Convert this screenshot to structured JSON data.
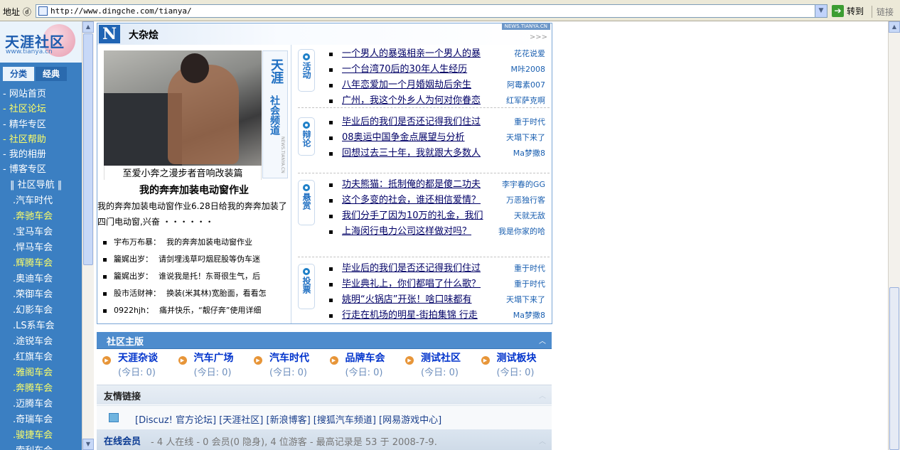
{
  "browser": {
    "address_label": "地址 ⓓ",
    "url": "http://www.dingche.com/tianya/",
    "go_label": "转到",
    "links_label": "链接"
  },
  "sidebar": {
    "logo_text": "天涯社区",
    "logo_sub": "www.tianya.cn",
    "tabs": [
      "分类",
      "经典"
    ],
    "nav": [
      {
        "label": "- 网站首页",
        "hl": false
      },
      {
        "label": "- 社区论坛",
        "hl": true
      },
      {
        "label": "- 精华专区",
        "hl": false
      },
      {
        "label": "- 社区帮助",
        "hl": true
      },
      {
        "label": "- 我的相册",
        "hl": false
      },
      {
        "label": "- 博客专区",
        "hl": false
      }
    ],
    "nav_head": "‖ 社区导航 ‖",
    "sub": [
      {
        "label": ".汽车时代",
        "hl": false
      },
      {
        "label": ".奔驰车会",
        "hl": true
      },
      {
        "label": ".宝马车会",
        "hl": false
      },
      {
        "label": ".悍马车会",
        "hl": false
      },
      {
        "label": ".辉腾车会",
        "hl": true
      },
      {
        "label": ".奥迪车会",
        "hl": false
      },
      {
        "label": ".荣御车会",
        "hl": false
      },
      {
        "label": ".幻影车会",
        "hl": false
      },
      {
        "label": ".LS系车会",
        "hl": false
      },
      {
        "label": ".途锐车会",
        "hl": false
      },
      {
        "label": ".红旗车会",
        "hl": false
      },
      {
        "label": ".雅阁车会",
        "hl": true
      },
      {
        "label": ".奔腾车会",
        "hl": true
      },
      {
        "label": ".迈腾车会",
        "hl": false
      },
      {
        "label": ".奇瑞车会",
        "hl": false
      },
      {
        "label": ".骏捷车会",
        "hl": true
      },
      {
        "label": ".索利车会",
        "hl": false
      }
    ]
  },
  "news": {
    "title": "大杂烩",
    "tag": "NEWS.TIANYA.CN",
    "more": ">>>",
    "photo_caption": "至爱小奔之漫步者音响改装篇",
    "channel_big": "天涯",
    "channel_small": "社会频道",
    "channel_tiny": "NEWS.TIANYA.CN",
    "headline": "我的奔奔加装电动窗作业",
    "summary": "我的奔奔加装电动窗作业6.28日给我的奔奔加装了四门电动窗,兴奋 ・・・・・・",
    "posts": [
      {
        "who": "宇布万布暴：",
        "text": "我的奔奔加装电动窗作业"
      },
      {
        "who": "籭娓出岁：",
        "text": "请剑埋浅草叼烟屁股等伪车迷"
      },
      {
        "who": "籭娓出岁：",
        "text": "谁说我是托！东哥很生气，后"
      },
      {
        "who": "股市活财神：",
        "text": "换装(米其林)宽胎面，看看怎"
      },
      {
        "who": "0922hjh：",
        "text": "痛并快乐，“靓仔奔”使用详细"
      }
    ],
    "categories": [
      {
        "name": "活动",
        "items": [
          {
            "title": "一个男人的暴强相亲一个男人的暴",
            "author": "花花说爱"
          },
          {
            "title": "一个台湾70后的30年人生经历",
            "author": "M咔2008"
          },
          {
            "title": "八年恋爱加一个月婚姻劫后余生",
            "author": "阿霉素007"
          },
          {
            "title": "广州，我这个外乡人为何对你眷恋",
            "author": "红军萨克啊"
          }
        ]
      },
      {
        "name": "辩论",
        "items": [
          {
            "title": "毕业后的我们是否还记得我们住过",
            "author": "重于时代"
          },
          {
            "title": "08奥运中国争金点展望与分析",
            "author": "天塌下来了"
          },
          {
            "title": "回想过去三十年，我就跟大多数人",
            "author": "Ma梦撒8"
          }
        ]
      },
      {
        "name": "悬赏",
        "items": [
          {
            "title": "功夫熊猫：抵制俺的都是傻二功夫",
            "author": "李宇春的GG"
          },
          {
            "title": "这个多变的社会，谁还相信爱情？",
            "author": "万恶独行客"
          },
          {
            "title": "我们分手了因为10万的礼金，我们",
            "author": "天就无敌"
          },
          {
            "title": "上海闵行电力公司这样做对吗？",
            "author": "我是你家的哈"
          }
        ]
      },
      {
        "name": "投票",
        "items": [
          {
            "title": "毕业后的我们是否还记得我们住过",
            "author": "重于时代"
          },
          {
            "title": "毕业典礼上，你们都唱了什么歌？",
            "author": "重于时代"
          },
          {
            "title": "姚明“火锅店”开张！啥口味都有",
            "author": "天塌下来了"
          },
          {
            "title": "行走在机场的明星-街拍集锦 行走",
            "author": "Ma梦撒8"
          }
        ]
      }
    ]
  },
  "forum": {
    "bar_title": "社区主版",
    "items": [
      {
        "name": "天涯杂谈",
        "today": "(今日: 0)"
      },
      {
        "name": "汽车广场",
        "today": "(今日: 0)"
      },
      {
        "name": "汽车时代",
        "today": "(今日: 0)"
      },
      {
        "name": "品牌车会",
        "today": "(今日: 0)"
      },
      {
        "name": "测试社区",
        "today": "(今日: 0)"
      },
      {
        "name": "测试板块",
        "today": "(今日: 0)"
      }
    ]
  },
  "friends": {
    "bar_title": "友情链接",
    "links": "[Discuz! 官方论坛] [天涯社区] [新浪博客] [搜狐汽车频道] [网易游戏中心]"
  },
  "online": {
    "title": "在线会员",
    "stats": "- 4 人在线 - 0 会员(0 隐身), 4 位游客 - 最高记录是 53 于 2008-7-9."
  }
}
